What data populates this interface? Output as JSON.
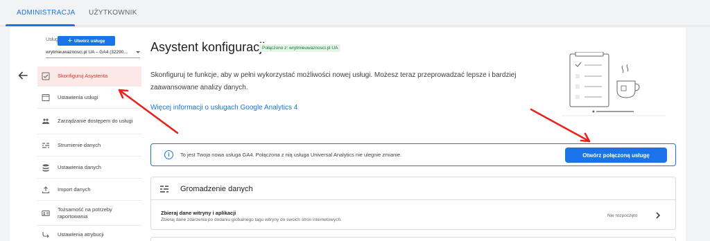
{
  "tabs": [
    {
      "label": "ADMINISTRACJA",
      "active": true
    },
    {
      "label": "UŻYTKOWNIK",
      "active": false
    }
  ],
  "sidebar": {
    "service_label": "Usługa",
    "create_button": "Utwórz usługę",
    "selected_service": "wrytmieuwaznosci.pl UA – GA4 (32290…",
    "items": [
      {
        "label": "Skonfiguruj Asystenta",
        "icon": "checkbox-icon",
        "active": true
      },
      {
        "label": "Ustawienia usługi",
        "icon": "settings-window-icon"
      },
      {
        "label": "Zarządzanie dostępem do usługi",
        "icon": "people-icon"
      },
      {
        "label": "Strumienie danych",
        "icon": "data-streams-icon"
      },
      {
        "label": "Ustawienia danych",
        "icon": "database-icon"
      },
      {
        "label": "Import danych",
        "icon": "upload-icon"
      },
      {
        "label": "Tożsamość na potrzeby raportowania",
        "icon": "identity-icon"
      },
      {
        "label": "Ustawienia atrybucji",
        "icon": "attribution-icon"
      }
    ]
  },
  "main": {
    "title": "Asystent konfiguracji",
    "connected_badge": "Połączono z: wrytmieuwaznosci.pl UA",
    "intro": "Skonfiguruj te funkcje, aby w pełni wykorzystać możliwości nowej usługi. Możesz teraz przeprowadzać lepsze i bardziej zaawansowane analizy danych.",
    "more_link": "Więcej informacji o usługach Google Analytics 4",
    "info_text": "To jest Twoja nowa usługa GA4. Połączona z nią usługa Universal Analytics nie ulegnie zmianie.",
    "open_button": "Otwórz połączoną usługę",
    "section": {
      "title": "Gromadzenie danych",
      "row_title": "Zbieraj dane witryny i aplikacji",
      "row_subtitle": "Zbieraj dane zdarzenia po dodaniu globalnego tagu witryny do swoich stron internetowych.",
      "status": "Nie rozpoczęto"
    }
  },
  "colors": {
    "accent": "#1a73e8",
    "annotation_arrow": "#e8231b",
    "active_item_bg": "#fce8e6",
    "active_item_text": "#d93025",
    "badge_bg": "#e6f4ea",
    "badge_text": "#137333"
  }
}
